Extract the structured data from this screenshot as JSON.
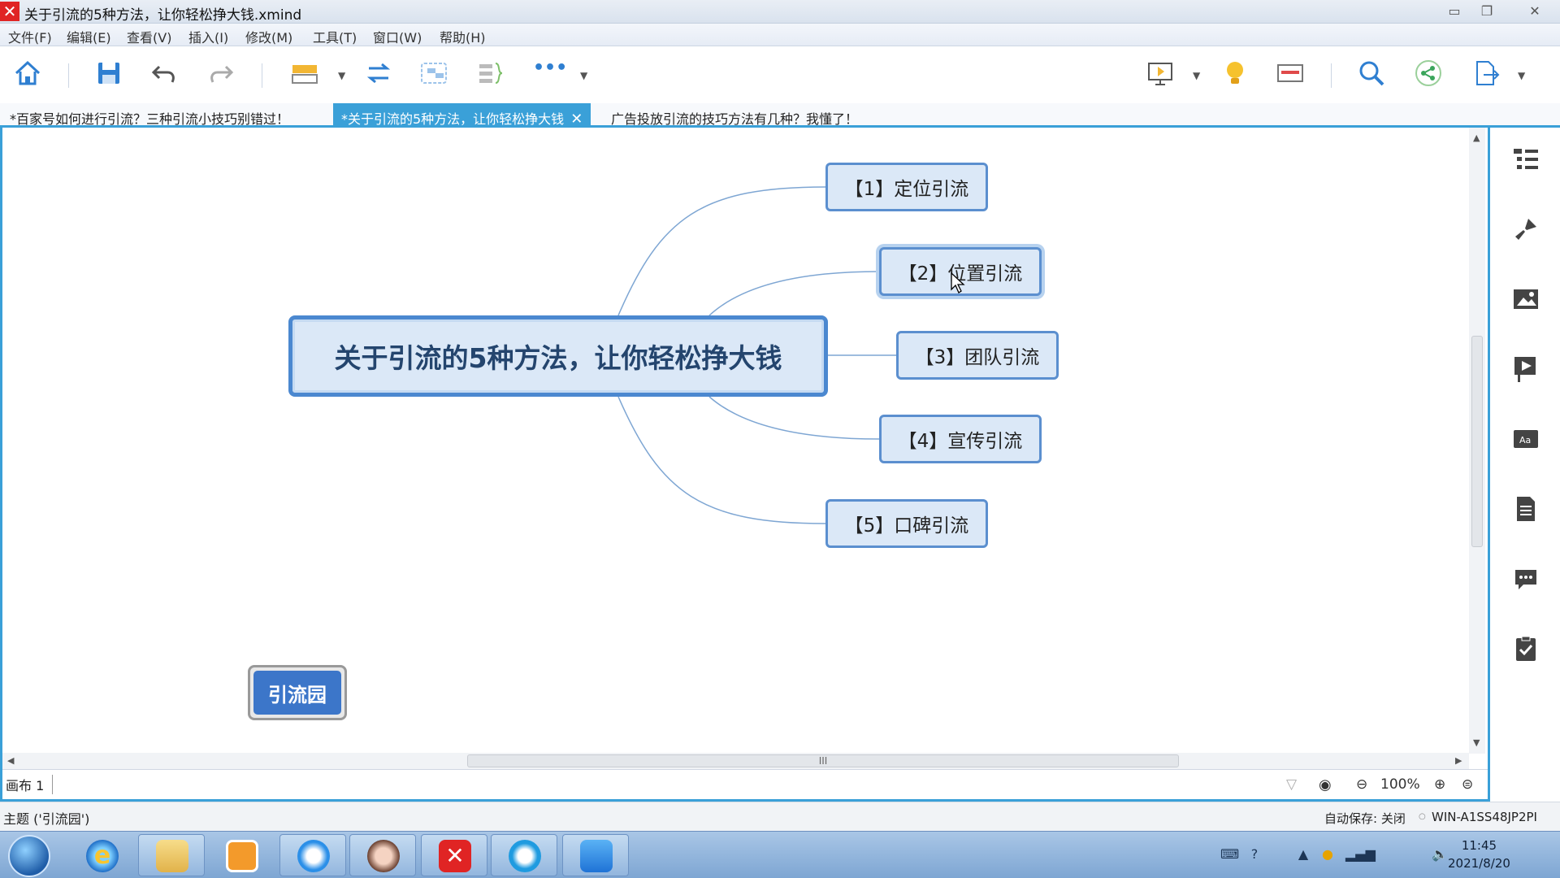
{
  "window": {
    "title": "关于引流的5种方法，让你轻松挣大钱.xmind",
    "app_icon": "xmind-logo-icon"
  },
  "menu": [
    "文件(F)",
    "编辑(E)",
    "查看(V)",
    "插入(I)",
    "修改(M)",
    "工具(T)",
    "窗口(W)",
    "帮助(H)"
  ],
  "toolbar": {
    "icons": [
      "home-icon",
      "save-icon",
      "undo-icon",
      "redo-icon",
      "topic-icon",
      "relationship-icon",
      "boundary-icon",
      "summary-icon",
      "more-icon",
      "presentation-icon",
      "idea-icon",
      "outline-icon",
      "search-icon",
      "share-icon",
      "export-icon"
    ],
    "more_label": "•••"
  },
  "tabs": [
    {
      "label": "*百家号如何进行引流？三种引流小技巧别错过！",
      "active": false
    },
    {
      "label": "*关于引流的5种方法，让你轻松挣大钱",
      "active": true,
      "close": "✕"
    },
    {
      "label": "广告投放引流的技巧方法有几种？我懂了！",
      "active": false
    }
  ],
  "mindmap": {
    "central_topic": "关于引流的5种方法，让你轻松挣大钱",
    "subtopics": [
      "【1】定位引流",
      "【2】位置引流",
      "【3】团队引流",
      "【4】宣传引流",
      "【5】口碑引流"
    ],
    "selected_index": 1,
    "floating_topic": "引流园",
    "colors": {
      "topic_border": "#4b88d0",
      "topic_fill": "#dbe8f7",
      "line": "#7ea6d3",
      "floating_fill": "#3c76c9"
    }
  },
  "sheetbar": {
    "sheet_tab": "画布 1",
    "zoom": "100%",
    "zoom_out": "⊖",
    "zoom_in": "⊕",
    "scroll_grip": "III"
  },
  "statusbar": {
    "left": "主题 ('引流园')",
    "autosave": "自动保存: 关闭",
    "machine": "WIN-A1SS48JP2PI"
  },
  "taskbar": {
    "apps": [
      "ie-icon",
      "file-explorer-icon",
      "media-player-icon",
      "qq-browser-icon",
      "photo-app-icon",
      "xmind-taskbar-icon",
      "chat-app-icon",
      "video-meeting-icon"
    ],
    "time": "11:45",
    "date": "2021/8/20"
  },
  "side_panel_icons": [
    "outline-panel-icon",
    "format-brush-icon",
    "image-icon",
    "flag-icon",
    "text-style-icon",
    "notes-icon",
    "comment-icon",
    "task-icon"
  ]
}
